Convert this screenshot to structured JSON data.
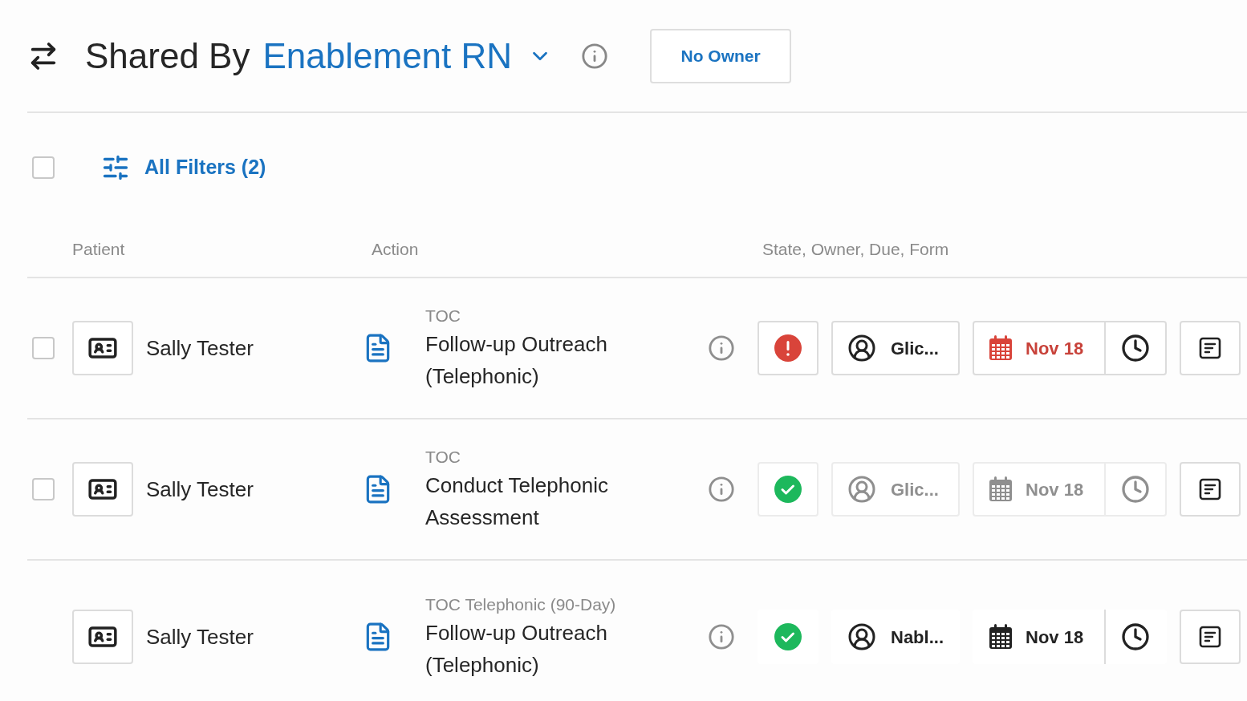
{
  "header": {
    "prefix": "Shared By",
    "team": "Enablement RN",
    "owner_button": "No Owner"
  },
  "toolbar": {
    "select_all": {
      "checked": false
    },
    "filters": "All Filters (2)"
  },
  "columns": [
    "Patient",
    "Action",
    "State, Owner, Due, Form"
  ],
  "rows": [
    {
      "checked": false,
      "patient": "Sally Tester",
      "category": "TOC",
      "title": "Follow-up Outreach (Telephonic)",
      "kind": "alert",
      "owner": "Glic...",
      "due": "Nov 18",
      "overdue": true,
      "muted": false,
      "framed": true
    },
    {
      "checked": false,
      "patient": "Sally Tester",
      "category": "TOC",
      "title": "Conduct Telephonic Assessment",
      "kind": "done",
      "owner": "Glic...",
      "due": "Nov 18",
      "overdue": false,
      "muted": true,
      "framed": true
    },
    {
      "patient": "Sally Tester",
      "category": "TOC Telephonic (90-Day)",
      "title": "Follow-up Outreach (Telephonic)",
      "kind": "done",
      "owner": "Nabl...",
      "due": "Nov 18",
      "overdue": false,
      "muted": false,
      "framed": false
    }
  ]
}
